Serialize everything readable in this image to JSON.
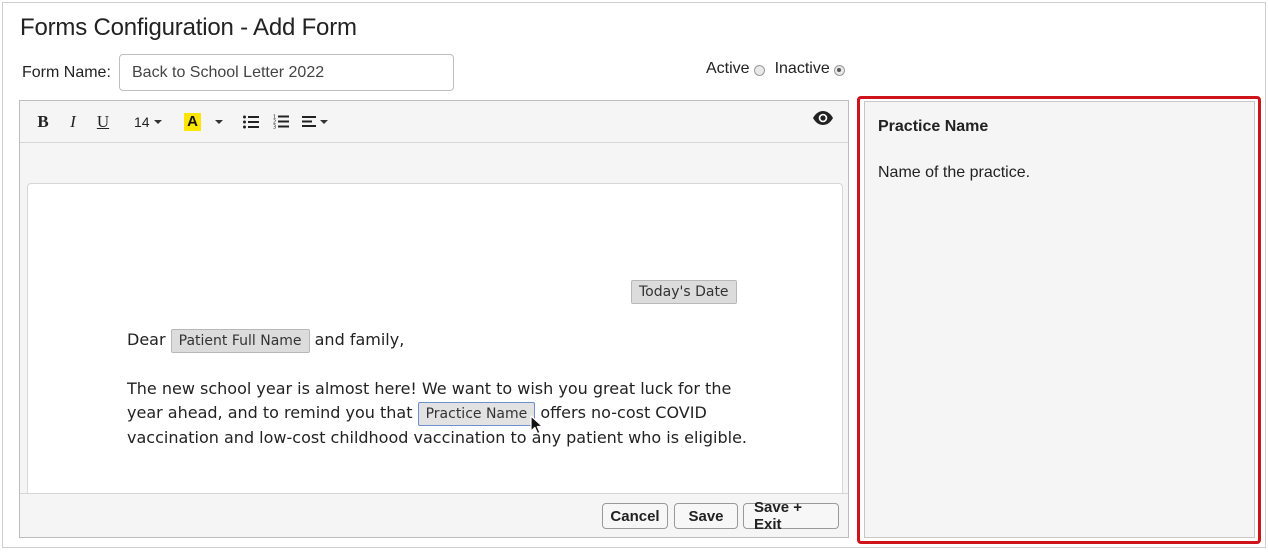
{
  "page": {
    "title": "Forms Configuration - Add Form"
  },
  "form": {
    "name_label": "Form Name:",
    "name_value": "Back to School Letter 2022",
    "status": {
      "active_label": "Active",
      "inactive_label": "Inactive",
      "selected": "Inactive"
    }
  },
  "toolbar": {
    "bold": "B",
    "italic": "I",
    "underline": "U",
    "font_size": "14",
    "highlight": "A",
    "icons": [
      "bold-icon",
      "italic-icon",
      "underline-icon",
      "font-size-dropdown",
      "highlight-color-icon",
      "bullet-list-icon",
      "numbered-list-icon",
      "align-icon",
      "preview-eye-icon"
    ],
    "highlight_color": "#ffe600"
  },
  "document": {
    "date_tag": "Today's Date",
    "greeting_prefix": "Dear",
    "patient_tag": "Patient Full Name",
    "greeting_suffix": "and family,",
    "para_part1": "The new school year is almost here! We want to wish you great luck for the year ahead, and to remind you that",
    "practice_tag": "Practice Name",
    "para_part2": "offers no-cost COVID vaccination and low-cost childhood vaccination to any patient who is eligible."
  },
  "footer": {
    "cancel": "Cancel",
    "save": "Save",
    "save_exit": "Save + Exit"
  },
  "side_panel": {
    "title": "Practice Name",
    "description": "Name of the practice.",
    "highlight_color": "#d0121b"
  }
}
